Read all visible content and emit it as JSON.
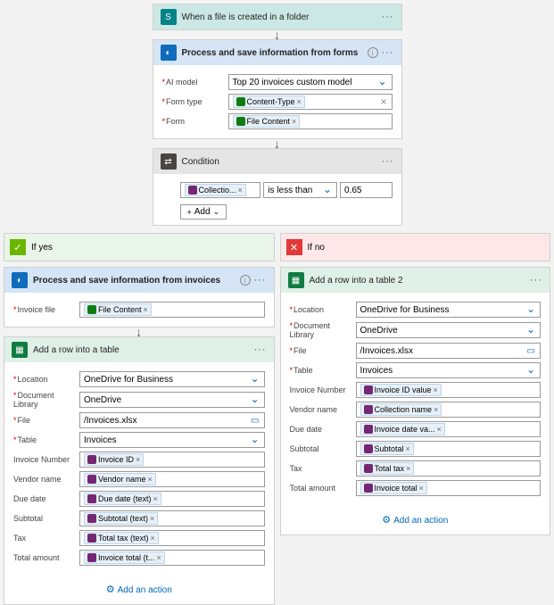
{
  "trigger": {
    "title": "When a file is created in a folder"
  },
  "process1": {
    "title": "Process and save information from forms",
    "model_lbl": "AI model",
    "model_val": "Top 20 invoices custom model",
    "formtype_lbl": "Form type",
    "formtype_tok": "Content-Type",
    "form_lbl": "Form",
    "form_tok": "File Content"
  },
  "condition": {
    "title": "Condition",
    "field_tok": "Collectio...",
    "op": "is less than",
    "val": "0.65",
    "add": "Add"
  },
  "yes": {
    "title": "If yes",
    "proc": {
      "title": "Process and save information from invoices",
      "file_lbl": "Invoice file",
      "file_tok": "File Content"
    },
    "table": {
      "title": "Add a row into a table",
      "loc_lbl": "Location",
      "loc_val": "OneDrive for Business",
      "lib_lbl": "Document Library",
      "lib_val": "OneDrive",
      "file_lbl": "File",
      "file_val": "/Invoices.xlsx",
      "tbl_lbl": "Table",
      "tbl_val": "Invoices",
      "r1_lbl": "Invoice Number",
      "r1_tok": "Invoice ID",
      "r2_lbl": "Vendor name",
      "r2_tok": "Vendor name",
      "r3_lbl": "Due date",
      "r3_tok": "Due date (text)",
      "r4_lbl": "Subtotal",
      "r4_tok": "Subtotal (text)",
      "r5_lbl": "Tax",
      "r5_tok": "Total tax (text)",
      "r6_lbl": "Total amount",
      "r6_tok": "Invoice total (t..."
    },
    "addact": "Add an action"
  },
  "no": {
    "title": "If no",
    "table": {
      "title": "Add a row into a table 2",
      "loc_lbl": "Location",
      "loc_val": "OneDrive for Business",
      "lib_lbl": "Document Library",
      "lib_val": "OneDrive",
      "file_lbl": "File",
      "file_val": "/Invoices.xlsx",
      "tbl_lbl": "Table",
      "tbl_val": "Invoices",
      "r1_lbl": "Invoice Number",
      "r1_tok": "Invoice ID value",
      "r2_lbl": "Vendor name",
      "r2_tok": "Collection name",
      "r3_lbl": "Due date",
      "r3_tok": "Invoice date va...",
      "r4_lbl": "Subtotal",
      "r4_tok": "Subtotal",
      "r5_lbl": "Tax",
      "r5_tok": "Total tax",
      "r6_lbl": "Total amount",
      "r6_tok": "Invoice total"
    },
    "addact": "Add an action"
  }
}
